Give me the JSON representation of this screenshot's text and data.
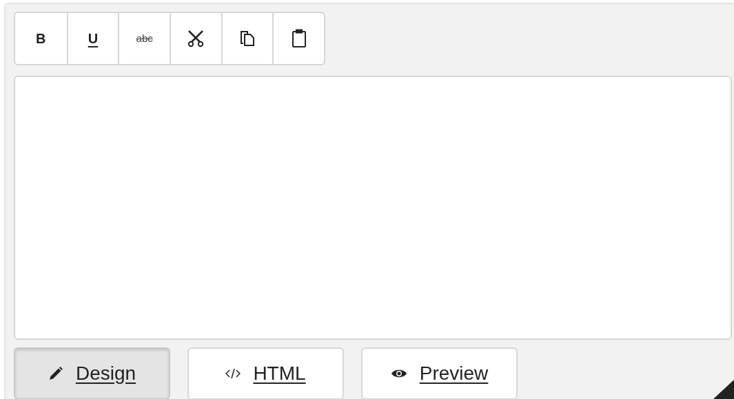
{
  "toolbar": [
    {
      "kind": "bold",
      "label": "B"
    },
    {
      "kind": "underline",
      "label": "U"
    },
    {
      "kind": "strike",
      "label": "abc"
    },
    {
      "kind": "cut"
    },
    {
      "kind": "copy"
    },
    {
      "kind": "paste"
    }
  ],
  "modes": [
    {
      "kind": "design",
      "label": "Design",
      "selected": true
    },
    {
      "kind": "html",
      "label": "HTML",
      "selected": false
    },
    {
      "kind": "preview",
      "label": "Preview",
      "selected": false
    }
  ]
}
